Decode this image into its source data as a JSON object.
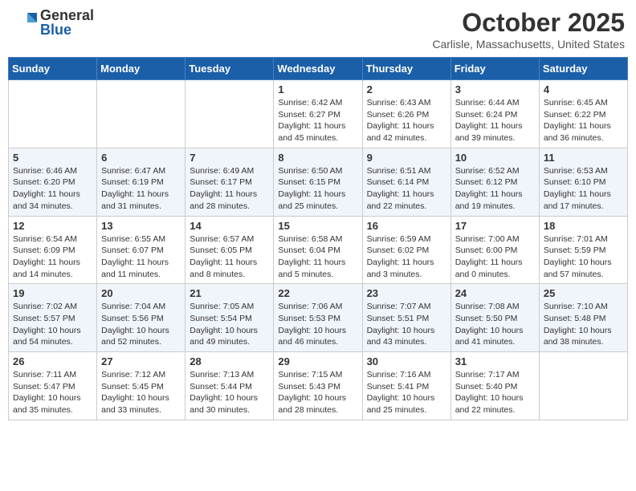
{
  "header": {
    "logo_general": "General",
    "logo_blue": "Blue",
    "month_title": "October 2025",
    "location": "Carlisle, Massachusetts, United States"
  },
  "weekdays": [
    "Sunday",
    "Monday",
    "Tuesday",
    "Wednesday",
    "Thursday",
    "Friday",
    "Saturday"
  ],
  "weeks": [
    [
      {
        "day": "",
        "info": ""
      },
      {
        "day": "",
        "info": ""
      },
      {
        "day": "",
        "info": ""
      },
      {
        "day": "1",
        "info": "Sunrise: 6:42 AM\nSunset: 6:27 PM\nDaylight: 11 hours\nand 45 minutes."
      },
      {
        "day": "2",
        "info": "Sunrise: 6:43 AM\nSunset: 6:26 PM\nDaylight: 11 hours\nand 42 minutes."
      },
      {
        "day": "3",
        "info": "Sunrise: 6:44 AM\nSunset: 6:24 PM\nDaylight: 11 hours\nand 39 minutes."
      },
      {
        "day": "4",
        "info": "Sunrise: 6:45 AM\nSunset: 6:22 PM\nDaylight: 11 hours\nand 36 minutes."
      }
    ],
    [
      {
        "day": "5",
        "info": "Sunrise: 6:46 AM\nSunset: 6:20 PM\nDaylight: 11 hours\nand 34 minutes."
      },
      {
        "day": "6",
        "info": "Sunrise: 6:47 AM\nSunset: 6:19 PM\nDaylight: 11 hours\nand 31 minutes."
      },
      {
        "day": "7",
        "info": "Sunrise: 6:49 AM\nSunset: 6:17 PM\nDaylight: 11 hours\nand 28 minutes."
      },
      {
        "day": "8",
        "info": "Sunrise: 6:50 AM\nSunset: 6:15 PM\nDaylight: 11 hours\nand 25 minutes."
      },
      {
        "day": "9",
        "info": "Sunrise: 6:51 AM\nSunset: 6:14 PM\nDaylight: 11 hours\nand 22 minutes."
      },
      {
        "day": "10",
        "info": "Sunrise: 6:52 AM\nSunset: 6:12 PM\nDaylight: 11 hours\nand 19 minutes."
      },
      {
        "day": "11",
        "info": "Sunrise: 6:53 AM\nSunset: 6:10 PM\nDaylight: 11 hours\nand 17 minutes."
      }
    ],
    [
      {
        "day": "12",
        "info": "Sunrise: 6:54 AM\nSunset: 6:09 PM\nDaylight: 11 hours\nand 14 minutes."
      },
      {
        "day": "13",
        "info": "Sunrise: 6:55 AM\nSunset: 6:07 PM\nDaylight: 11 hours\nand 11 minutes."
      },
      {
        "day": "14",
        "info": "Sunrise: 6:57 AM\nSunset: 6:05 PM\nDaylight: 11 hours\nand 8 minutes."
      },
      {
        "day": "15",
        "info": "Sunrise: 6:58 AM\nSunset: 6:04 PM\nDaylight: 11 hours\nand 5 minutes."
      },
      {
        "day": "16",
        "info": "Sunrise: 6:59 AM\nSunset: 6:02 PM\nDaylight: 11 hours\nand 3 minutes."
      },
      {
        "day": "17",
        "info": "Sunrise: 7:00 AM\nSunset: 6:00 PM\nDaylight: 11 hours\nand 0 minutes."
      },
      {
        "day": "18",
        "info": "Sunrise: 7:01 AM\nSunset: 5:59 PM\nDaylight: 10 hours\nand 57 minutes."
      }
    ],
    [
      {
        "day": "19",
        "info": "Sunrise: 7:02 AM\nSunset: 5:57 PM\nDaylight: 10 hours\nand 54 minutes."
      },
      {
        "day": "20",
        "info": "Sunrise: 7:04 AM\nSunset: 5:56 PM\nDaylight: 10 hours\nand 52 minutes."
      },
      {
        "day": "21",
        "info": "Sunrise: 7:05 AM\nSunset: 5:54 PM\nDaylight: 10 hours\nand 49 minutes."
      },
      {
        "day": "22",
        "info": "Sunrise: 7:06 AM\nSunset: 5:53 PM\nDaylight: 10 hours\nand 46 minutes."
      },
      {
        "day": "23",
        "info": "Sunrise: 7:07 AM\nSunset: 5:51 PM\nDaylight: 10 hours\nand 43 minutes."
      },
      {
        "day": "24",
        "info": "Sunrise: 7:08 AM\nSunset: 5:50 PM\nDaylight: 10 hours\nand 41 minutes."
      },
      {
        "day": "25",
        "info": "Sunrise: 7:10 AM\nSunset: 5:48 PM\nDaylight: 10 hours\nand 38 minutes."
      }
    ],
    [
      {
        "day": "26",
        "info": "Sunrise: 7:11 AM\nSunset: 5:47 PM\nDaylight: 10 hours\nand 35 minutes."
      },
      {
        "day": "27",
        "info": "Sunrise: 7:12 AM\nSunset: 5:45 PM\nDaylight: 10 hours\nand 33 minutes."
      },
      {
        "day": "28",
        "info": "Sunrise: 7:13 AM\nSunset: 5:44 PM\nDaylight: 10 hours\nand 30 minutes."
      },
      {
        "day": "29",
        "info": "Sunrise: 7:15 AM\nSunset: 5:43 PM\nDaylight: 10 hours\nand 28 minutes."
      },
      {
        "day": "30",
        "info": "Sunrise: 7:16 AM\nSunset: 5:41 PM\nDaylight: 10 hours\nand 25 minutes."
      },
      {
        "day": "31",
        "info": "Sunrise: 7:17 AM\nSunset: 5:40 PM\nDaylight: 10 hours\nand 22 minutes."
      },
      {
        "day": "",
        "info": ""
      }
    ]
  ]
}
